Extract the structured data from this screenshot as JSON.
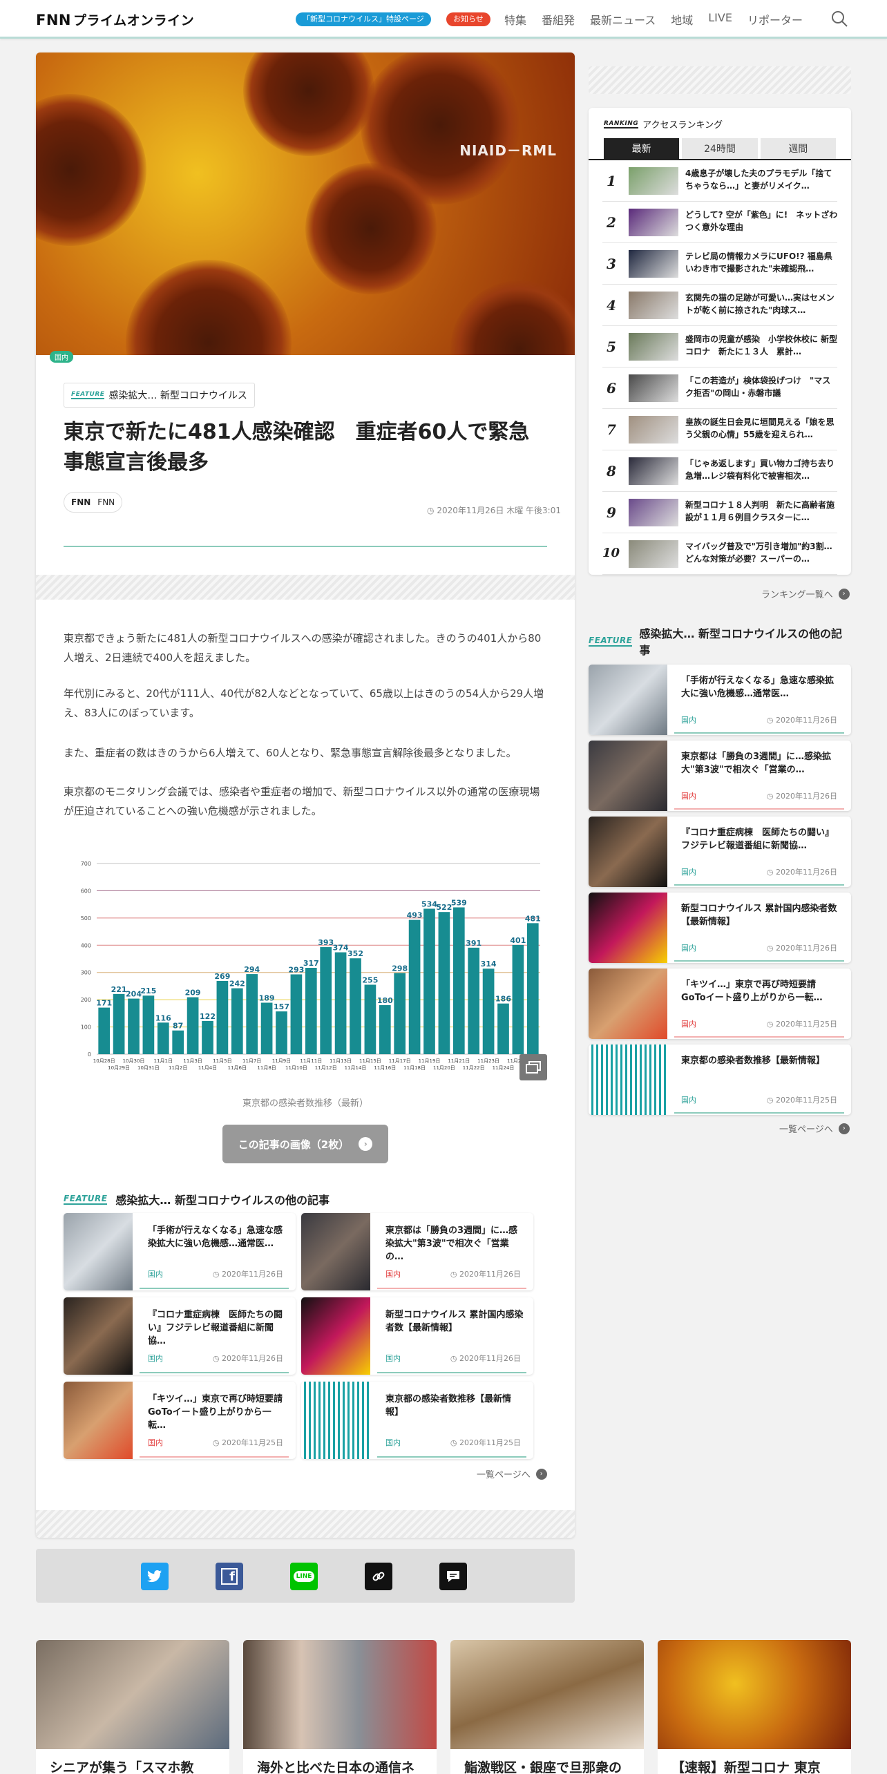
{
  "header": {
    "logo_mark": "FNN",
    "logo_text": "プライムオンライン",
    "covid_pill": "「新型コロナウイルス」特設ページ",
    "notice_pill": "お知らせ",
    "nav": [
      "特集",
      "番組発",
      "最新ニュース",
      "地域",
      "LIVE",
      "リポーター"
    ]
  },
  "article": {
    "hero_credit": "NIAID－RML",
    "hero_tag": "国内",
    "feature_label": "FEATURE",
    "feature_name": "感染拡大… 新型コロナウイルス",
    "title": "東京で新たに481人感染確認　重症者60人で緊急事態宣言後最多",
    "source": "FNN",
    "date": "2020年11月26日 木曜 午後3:01",
    "paragraphs": [
      "東京都できょう新たに481人の新型コロナウイルスへの感染が確認されました。きのうの401人から80人増え、2日連続で400人を超えました。",
      "年代別にみると、20代が111人、40代が82人などとなっていて、65歳以上はきのうの54人から29人増え、83人にのぼっています。",
      "また、重症者の数はきのうから6人増えて、60人となり、緊急事態宣言解除後最多となりました。",
      "東京都のモニタリング会議では、感染者や重症者の増加で、新型コロナウイルス以外の通常の医療現場が圧迫されていることへの強い危機感が示されました。"
    ],
    "chart_caption": "東京都の感染者数推移（最新）",
    "images_button": "この記事の画像（2枚）"
  },
  "chart_data": {
    "type": "bar",
    "categories": [
      "10月28日",
      "10月29日",
      "10月30日",
      "10月31日",
      "11月1日",
      "11月2日",
      "11月3日",
      "11月4日",
      "11月5日",
      "11月6日",
      "11月7日",
      "11月8日",
      "11月9日",
      "11月10日",
      "11月11日",
      "11月12日",
      "11月13日",
      "11月14日",
      "11月15日",
      "11月16日",
      "11月17日",
      "11月18日",
      "11月19日",
      "11月20日",
      "11月21日",
      "11月22日",
      "11月23日",
      "11月24日",
      "11月25日",
      "11月26日"
    ],
    "values": [
      171,
      221,
      204,
      215,
      116,
      87,
      209,
      122,
      269,
      242,
      294,
      189,
      157,
      293,
      317,
      393,
      374,
      352,
      255,
      180,
      298,
      493,
      534,
      522,
      539,
      391,
      314,
      186,
      401,
      481
    ],
    "ylim": [
      0,
      700
    ],
    "yticks": [
      0,
      100,
      200,
      300,
      400,
      500,
      600,
      700
    ],
    "bar_color": "#178c91",
    "title": "",
    "xlabel": "",
    "ylabel": ""
  },
  "related": {
    "label": "FEATURE",
    "heading": "感染拡大… 新型コロナウイルスの他の記事",
    "more": "一覧ページへ",
    "items": [
      {
        "title": "「手術が行えなくなる」急速な感染拡大に強い危機感…通常医…",
        "cat": "国内",
        "date": "2020年11月26日",
        "side_title": "「手術が行えなくなる」急速な感染拡大に強い危機感…通常医…"
      },
      {
        "title": "東京都は「勝負の3週間」に…感染拡大\"第3波\"で相次ぐ「営業の…",
        "cat": "国内",
        "date": "2020年11月26日",
        "side_title": "東京都は「勝負の3週間」に…感染拡大\"第3波\"で相次ぐ「営業の…"
      },
      {
        "title": "『コロナ重症病棟　医師たちの闘い』フジテレビ報道番組に新聞協…",
        "cat": "国内",
        "date": "2020年11月26日",
        "side_title": "『コロナ重症病棟　医師たちの闘い』フジテレビ報道番組に新聞協…"
      },
      {
        "title": "新型コロナウイルス 累計国内感染者数【最新情報】",
        "cat": "国内",
        "date": "2020年11月26日",
        "side_title": "新型コロナウイルス 累計国内感染者数【最新情報】"
      },
      {
        "title": "「キツイ…」東京で再び時短要請 GoToイート盛り上がりから一転…",
        "cat": "国内",
        "date": "2020年11月25日",
        "side_title": "「キツイ…」東京で再び時短要請 GoToイート盛り上がりから一転…"
      },
      {
        "title": "東京都の感染者数推移【最新情報】",
        "cat": "国内",
        "date": "2020年11月25日",
        "side_title": "東京都の感染者数推移【最新情報】"
      }
    ]
  },
  "ranking": {
    "label": "RANKING",
    "title": "アクセスランキング",
    "tabs": [
      "最新",
      "24時間",
      "週間"
    ],
    "more": "ランキング一覧へ",
    "items": [
      {
        "rank": "1",
        "text": "4歳息子が壊した夫のプラモデル「捨てちゃうなら…」と妻がリメイク…"
      },
      {
        "rank": "2",
        "text": "どうして? 空が「紫色」に!　ネットざわつく意外な理由"
      },
      {
        "rank": "3",
        "text": "テレビ局の情報カメラにUFO!? 福島県いわき市で撮影された\"未確認飛…"
      },
      {
        "rank": "4",
        "text": "玄関先の猫の足跡が可愛い…実はセメントが乾く前に捺された\"肉球ス…"
      },
      {
        "rank": "5",
        "text": "盛岡市の児童が感染　小学校休校に 新型コロナ　新たに１３人　累計…"
      },
      {
        "rank": "6",
        "text": "「この若造が」検体袋投げつけ　\"マスク拒否\"の岡山・赤磐市議"
      },
      {
        "rank": "7",
        "text": "皇族の誕生日会見に垣間見える「娘を思う父親の心情」55歳を迎えられ…"
      },
      {
        "rank": "8",
        "text": "「じゃあ返します」買い物カゴ持ち去り急増…レジ袋有料化で被害相次…"
      },
      {
        "rank": "9",
        "text": "新型コロナ１８人判明　新たに高齢者施設が１１月６例目クラスターに…"
      },
      {
        "rank": "10",
        "text": "マイバッグ普及で\"万引き増加\"約3割…どんな対策が必要？スーパーの…"
      }
    ]
  },
  "bottom": [
    {
      "title": "シニアが集う「スマホ教"
    },
    {
      "title": "海外と比べた日本の通信ネ"
    },
    {
      "title": "鮨激戦区・銀座で旦那衆の"
    },
    {
      "title": "【速報】新型コロナ 東京"
    }
  ],
  "colors": {
    "accent": "#2ea39a",
    "tag_green": "#2db38a",
    "cat_red": "#e23c3c",
    "twitter": "#1da1f2",
    "facebook": "#3b5998",
    "line": "#00c300"
  }
}
